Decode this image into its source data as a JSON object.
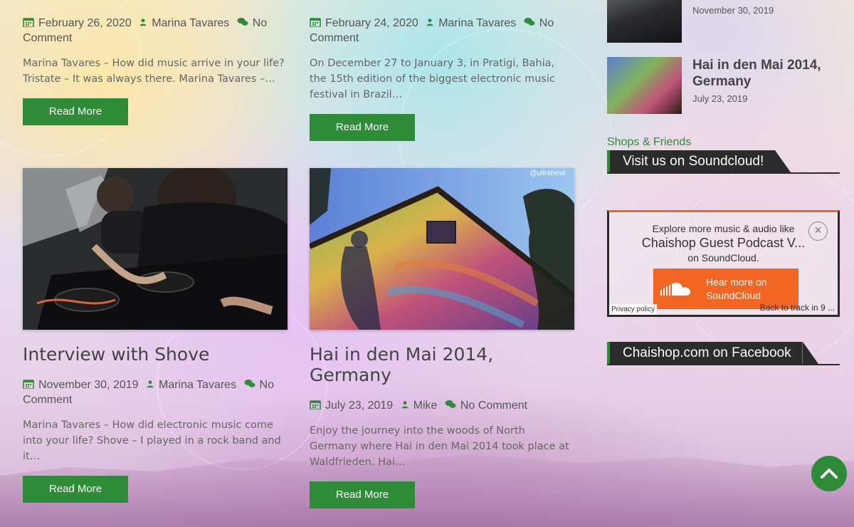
{
  "colors": {
    "accent": "#2e8b38",
    "dark": "#2b2b2b",
    "soundcloud": "#f26522"
  },
  "posts": [
    {
      "date": "February 26, 2020",
      "author": "Marina Tavares",
      "comments": "No Comment",
      "excerpt": "Marina Tavares – How did music arrive in your life? Tristate – It was always there.   Marina Tavares –…",
      "read_more": "Read More"
    },
    {
      "date": "February 24, 2020",
      "author": "Marina Tavares",
      "comments": "No Comment",
      "excerpt": "On December 27 to January 3, in Pratigi, Bahia, the 15th edition of the biggest electronic music festival in Brazil…",
      "read_more": "Read More"
    },
    {
      "title": "Interview with Shove",
      "image": "dj-mixer-photo",
      "date": "November 30, 2019",
      "author": "Marina Tavares",
      "comments": "No Comment",
      "excerpt": "Marina Tavares – How did electronic music come into your life? Shove – I played in a rock band and it…",
      "read_more": "Read More"
    },
    {
      "title": "Hai in den Mai 2014, Germany",
      "image": "painted-house-photo",
      "image_watermark": "@ultrabesk",
      "date": "July 23, 2019",
      "author": "Mike",
      "comments": "No Comment",
      "excerpt": "Enjoy the journey into the woods of North Germany where Hai in den Mai 2014 took place at Waldfrieden. Hai…",
      "read_more": "Read More"
    }
  ],
  "sidebar": {
    "recent_posts": [
      {
        "title": "",
        "date": "November 30, 2019"
      },
      {
        "title": "Hai in den Mai 2014, Germany",
        "date": "July 23, 2019"
      }
    ],
    "shops_link": "Shops & Friends",
    "soundcloud_widget": {
      "heading": "Visit us on Soundcloud!",
      "explore": "Explore more music & audio like",
      "track": "Chaishop Guest Podcast V...",
      "on": "on SoundCloud.",
      "button": "Hear more on SoundCloud",
      "privacy": "Privacy policy",
      "back": "Back to track in 9 ..."
    },
    "facebook_heading": "Chaishop.com on Facebook"
  }
}
